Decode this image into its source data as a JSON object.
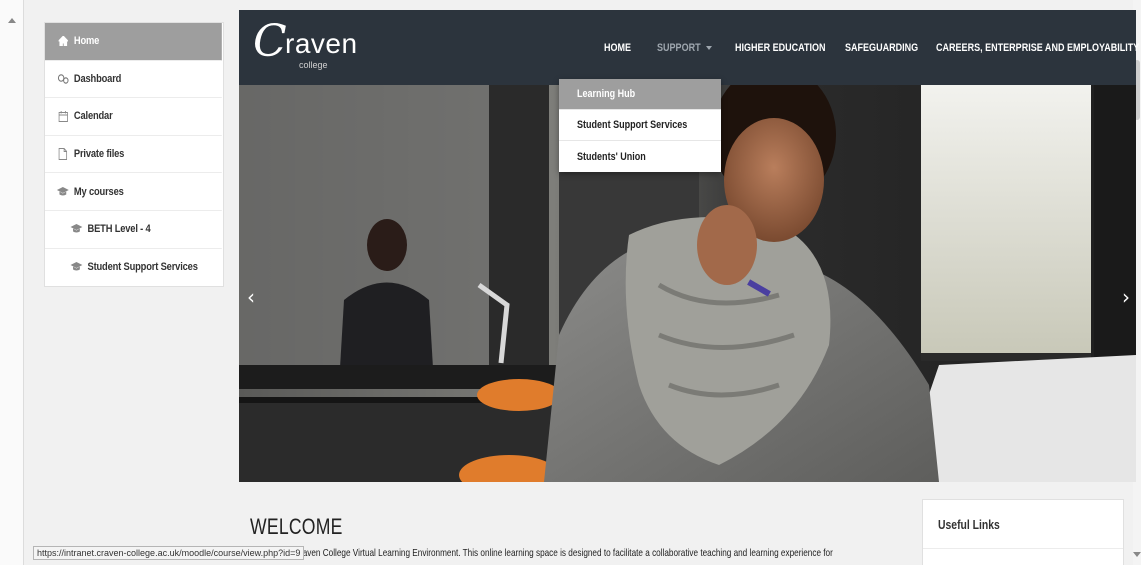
{
  "sidebar": {
    "items": [
      {
        "label": "Home",
        "icon": "home-icon",
        "active": true
      },
      {
        "label": "Dashboard",
        "icon": "dashboard-icon"
      },
      {
        "label": "Calendar",
        "icon": "calendar-icon"
      },
      {
        "label": "Private files",
        "icon": "file-icon"
      },
      {
        "label": "My courses",
        "icon": "graduation-cap-icon"
      },
      {
        "label": "BETH Level - 4",
        "icon": "graduation-cap-icon"
      },
      {
        "label": "Student Support Services",
        "icon": "graduation-cap-icon"
      }
    ]
  },
  "header": {
    "logo_letter": "C",
    "logo_word": "raven",
    "logo_sub": "college",
    "nav": {
      "home": "HOME",
      "support": "SUPPORT",
      "higher": "HIGHER EDUCATION",
      "safeguarding": "SAFEGUARDING",
      "careers": "CAREERS, ENTERPRISE AND EMPLOYABILITY"
    }
  },
  "dropdown": {
    "items": [
      "Learning Hub",
      "Student Support Services",
      "Students' Union"
    ]
  },
  "hero": {
    "prev": "‹",
    "next": "›"
  },
  "welcome": {
    "title": "WELCOME",
    "text": "raven College Virtual Learning Environment. This online learning space is designed to facilitate a collaborative teaching and learning experience for"
  },
  "useful_links": {
    "title": "Useful Links"
  },
  "status": {
    "url": "https://intranet.craven-college.ac.uk/moodle/course/view.php?id=9"
  },
  "colors": {
    "header_bg": "#2c343d",
    "active_bg": "#9e9e9e",
    "page_bg": "#f1f1f1"
  }
}
